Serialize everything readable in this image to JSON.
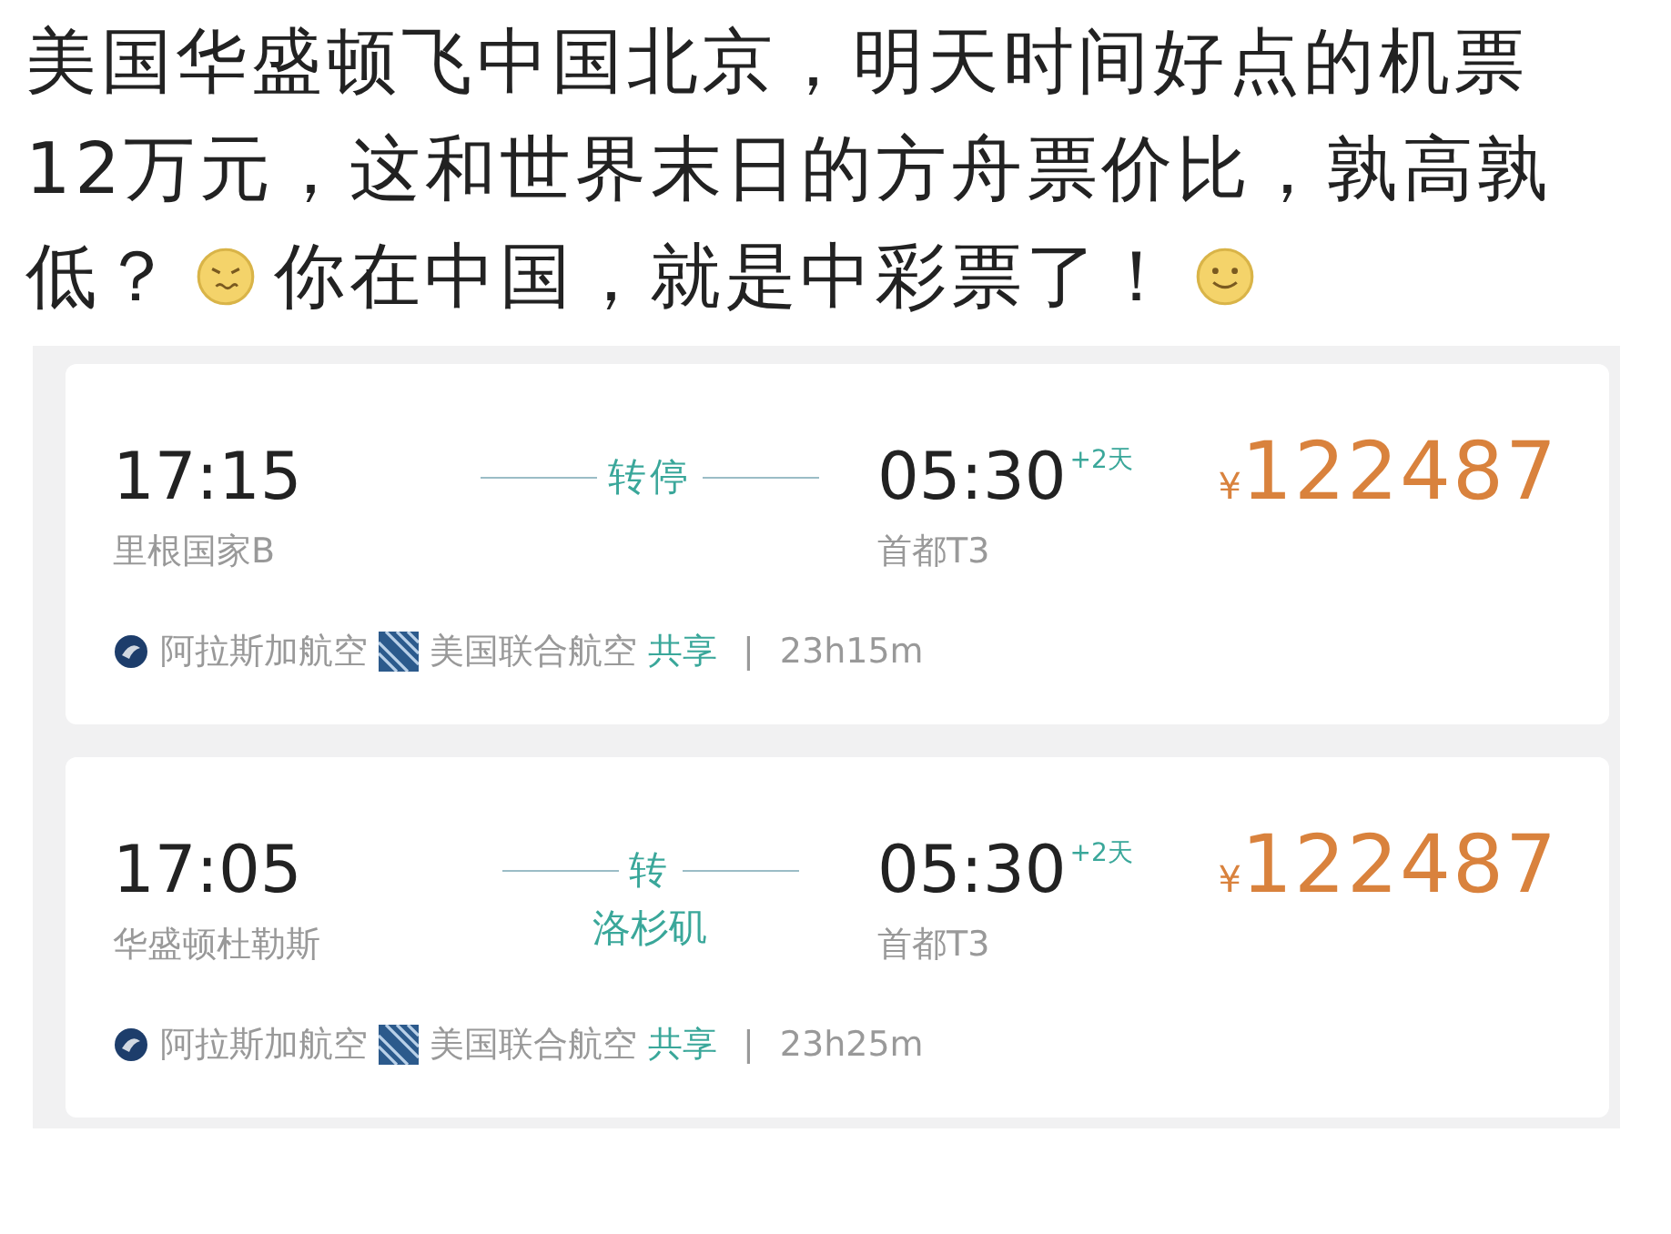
{
  "post": {
    "lines": [
      [
        {
          "kind": "text",
          "text": "美国华盛顿飞中国北京，明天时间好点的机票"
        }
      ],
      [
        {
          "kind": "text",
          "text": "12万元，这和世界末日的方舟票价比，孰高孰"
        }
      ],
      [
        {
          "kind": "text",
          "text": "低？"
        },
        {
          "kind": "frown"
        },
        {
          "kind": "text",
          "text": "你在中国，就是中彩票了！"
        },
        {
          "kind": "smile"
        }
      ]
    ]
  },
  "flights": [
    {
      "depart_time": "17:15",
      "depart_airport": "里根国家B",
      "stop_label": "转停",
      "arrive_time": "05:30",
      "day_offset": "+2天",
      "arrive_airport": "首都T3",
      "currency": "¥",
      "price": "122487",
      "airlines": [
        {
          "kind": "round",
          "name": "阿拉斯加航空"
        },
        {
          "kind": "striped",
          "name": "美国联合航空"
        }
      ],
      "share": "共享",
      "separator": "|",
      "duration": "23h15m"
    },
    {
      "depart_time": "17:05",
      "depart_airport": "华盛顿杜勒斯",
      "stop_label": "转",
      "stop_city": "洛杉矶",
      "arrive_time": "05:30",
      "day_offset": "+2天",
      "arrive_airport": "首都T3",
      "currency": "¥",
      "price": "122487",
      "airlines": [
        {
          "kind": "round",
          "name": "阿拉斯加航空"
        },
        {
          "kind": "striped",
          "name": "美国联合航空"
        }
      ],
      "share": "共享",
      "separator": "|",
      "duration": "23h25m"
    }
  ]
}
